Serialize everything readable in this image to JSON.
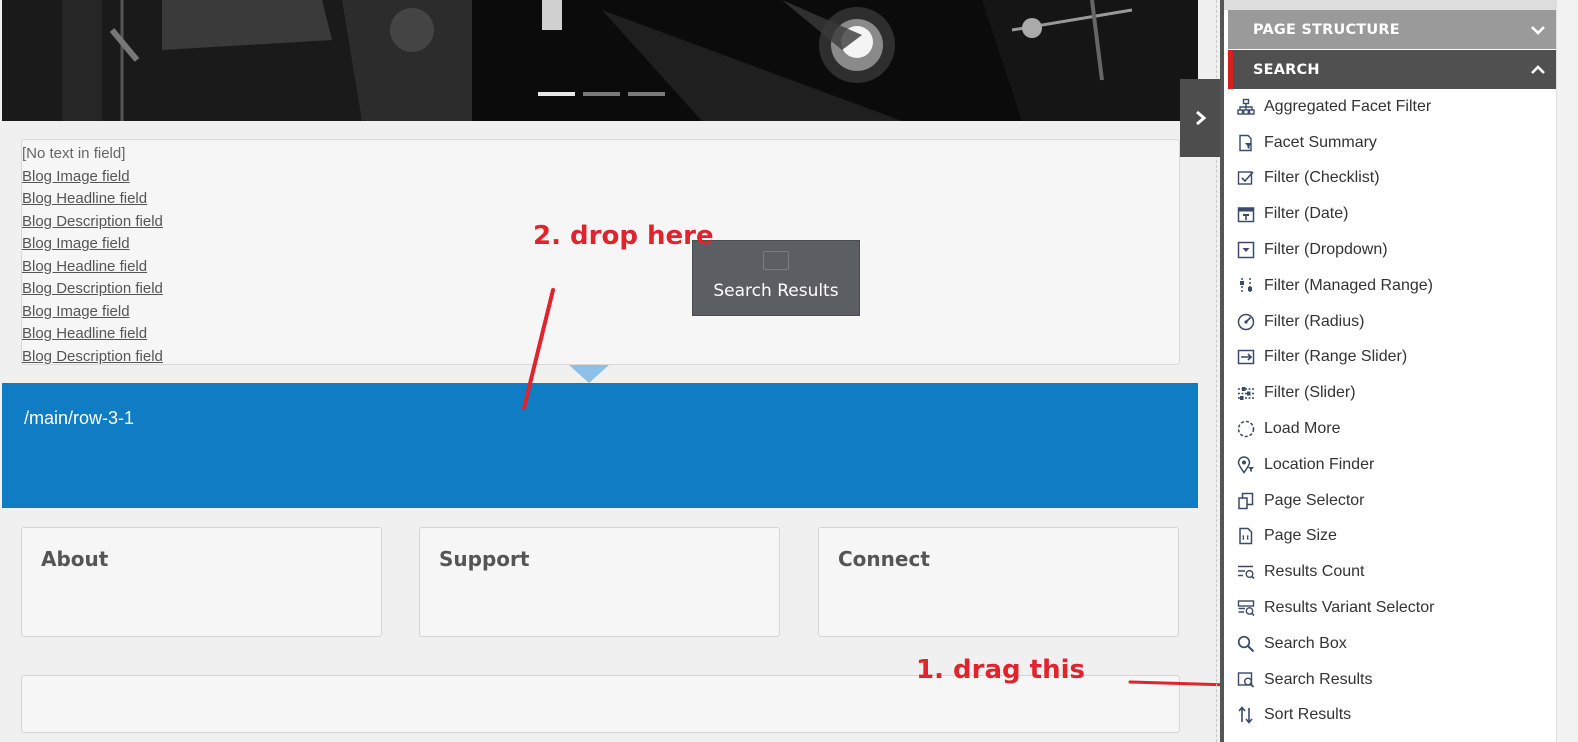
{
  "page": {
    "empty_field": "[No text in field]",
    "fields": [
      "Blog Image field",
      "Blog Headline field",
      "Blog Description field",
      "Blog Image field",
      "Blog Headline field",
      "Blog Description field",
      "Blog Image field",
      "Blog Headline field",
      "Blog Description field"
    ],
    "row_path": "/main/row-3-1",
    "footer_cards": [
      "About",
      "Support",
      "Connect"
    ],
    "carousel": {
      "slides": 3,
      "active": 1
    }
  },
  "drag_tile": {
    "label": "Search Results",
    "icon": "search-results-icon"
  },
  "annotations": {
    "drop": "2. drop here",
    "drag": "1. drag this",
    "color": "#e0232d"
  },
  "toolbox": {
    "sections": [
      {
        "label": "PAGE STRUCTURE",
        "state": "collapsed",
        "icon": "chevron-down-icon"
      },
      {
        "label": "SEARCH",
        "state": "expanded",
        "icon": "chevron-up-icon"
      }
    ],
    "items": [
      {
        "label": "Aggregated Facet Filter",
        "icon": "hierarchy-icon"
      },
      {
        "label": "Facet Summary",
        "icon": "document-filter-icon"
      },
      {
        "label": "Filter (Checklist)",
        "icon": "checkbox-icon"
      },
      {
        "label": "Filter (Date)",
        "icon": "calendar-icon"
      },
      {
        "label": "Filter (Dropdown)",
        "icon": "dropdown-icon"
      },
      {
        "label": "Filter (Managed Range)",
        "icon": "sliders-vertical-icon"
      },
      {
        "label": "Filter (Radius)",
        "icon": "gauge-icon"
      },
      {
        "label": "Filter (Range Slider)",
        "icon": "range-slider-icon"
      },
      {
        "label": "Filter (Slider)",
        "icon": "slider-icon"
      },
      {
        "label": "Load More",
        "icon": "spinner-icon"
      },
      {
        "label": "Location Finder",
        "icon": "location-pin-icon"
      },
      {
        "label": "Page Selector",
        "icon": "pages-icon"
      },
      {
        "label": "Page Size",
        "icon": "page-size-icon"
      },
      {
        "label": "Results Count",
        "icon": "results-count-icon"
      },
      {
        "label": "Results Variant Selector",
        "icon": "variant-selector-icon"
      },
      {
        "label": "Search Box",
        "icon": "search-icon"
      },
      {
        "label": "Search Results",
        "icon": "search-results-icon"
      },
      {
        "label": "Sort Results",
        "icon": "sort-icon"
      }
    ],
    "accent_color": "#d62020"
  }
}
